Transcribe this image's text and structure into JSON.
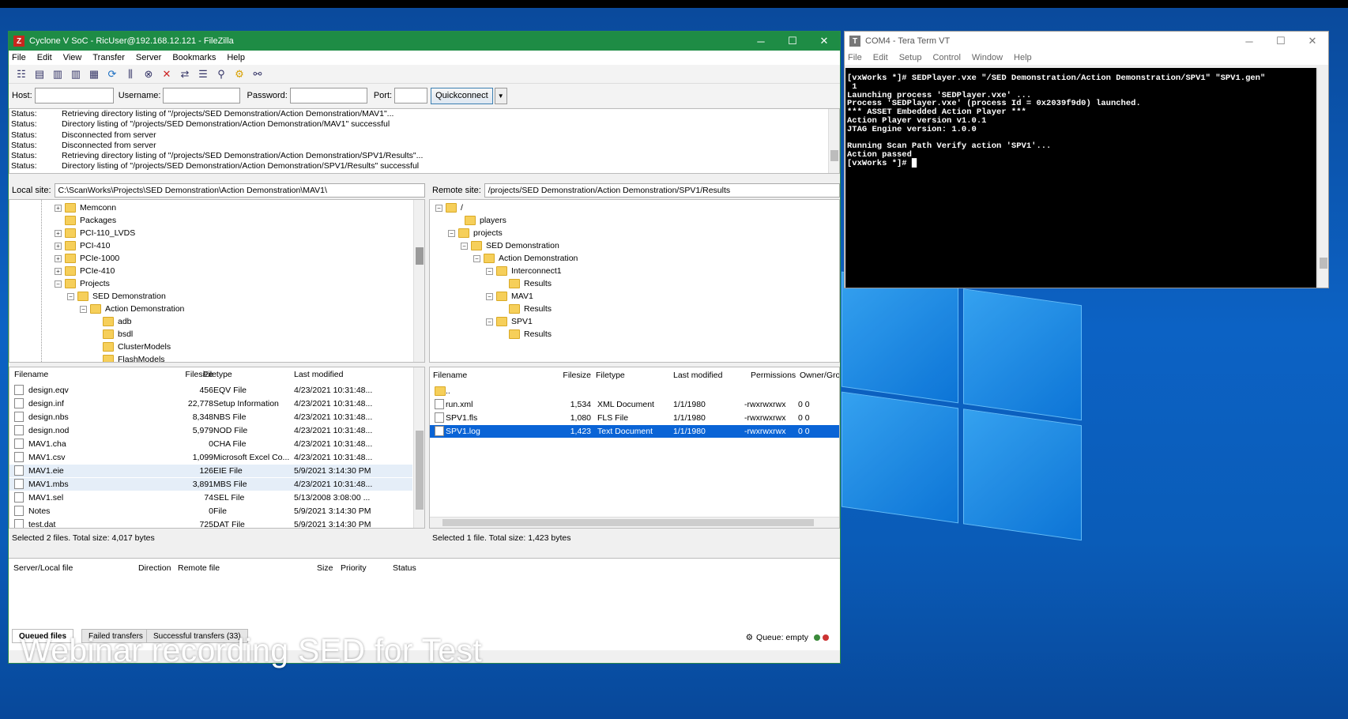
{
  "caption": "Webinar recording SED for Test",
  "filezilla": {
    "title": "Cyclone V SoC - RicUser@192.168.12.121 - FileZilla",
    "window_controls": [
      "─",
      "☐",
      "✕"
    ],
    "menu": [
      "File",
      "Edit",
      "View",
      "Transfer",
      "Server",
      "Bookmarks",
      "Help"
    ],
    "quickconnect": {
      "host_label": "Host:",
      "username_label": "Username:",
      "password_label": "Password:",
      "port_label": "Port:",
      "button": "Quickconnect",
      "host_value": "",
      "username_value": "",
      "password_value": "",
      "port_value": ""
    },
    "log": [
      {
        "k": "Status:",
        "v": "Retrieving directory listing of \"/projects/SED Demonstration/Action Demonstration/MAV1\"..."
      },
      {
        "k": "Status:",
        "v": "Directory listing of \"/projects/SED Demonstration/Action Demonstration/MAV1\" successful"
      },
      {
        "k": "Status:",
        "v": "Disconnected from server"
      },
      {
        "k": "Status:",
        "v": "Disconnected from server"
      },
      {
        "k": "Status:",
        "v": "Retrieving directory listing of \"/projects/SED Demonstration/Action Demonstration/SPV1/Results\"..."
      },
      {
        "k": "Status:",
        "v": "Directory listing of \"/projects/SED Demonstration/Action Demonstration/SPV1/Results\" successful"
      }
    ],
    "local": {
      "label": "Local site:",
      "path": "C:\\ScanWorks\\Projects\\SED Demonstration\\Action Demonstration\\MAV1\\",
      "tree": [
        "Memconn",
        "Packages",
        "PCI-110_LVDS",
        "PCI-410",
        "PCIe-1000",
        "PCIe-410",
        "Projects",
        "SED Demonstration",
        "Action Demonstration",
        "adb",
        "bsdl",
        "ClusterModels",
        "FlashModels"
      ],
      "headers": [
        "Filename",
        "Filesize",
        "Filetype",
        "Last modified"
      ],
      "files": [
        [
          "design.eqv",
          "456",
          "EQV File",
          "4/23/2021 10:31:48..."
        ],
        [
          "design.inf",
          "22,778",
          "Setup Information",
          "4/23/2021 10:31:48..."
        ],
        [
          "design.nbs",
          "8,348",
          "NBS File",
          "4/23/2021 10:31:48..."
        ],
        [
          "design.nod",
          "5,979",
          "NOD File",
          "4/23/2021 10:31:48..."
        ],
        [
          "MAV1.cha",
          "0",
          "CHA File",
          "4/23/2021 10:31:48..."
        ],
        [
          "MAV1.csv",
          "1,099",
          "Microsoft Excel Co...",
          "4/23/2021 10:31:48..."
        ],
        [
          "MAV1.eie",
          "126",
          "EIE File",
          "5/9/2021 3:14:30 PM"
        ],
        [
          "MAV1.mbs",
          "3,891",
          "MBS File",
          "4/23/2021 10:31:48..."
        ],
        [
          "MAV1.sel",
          "74",
          "SEL File",
          "5/13/2008 3:08:00 ..."
        ],
        [
          "Notes",
          "0",
          "File",
          "5/9/2021 3:14:30 PM"
        ],
        [
          "test.dat",
          "725",
          "DAT File",
          "5/9/2021 3:14:30 PM"
        ]
      ],
      "status": "Selected 2 files. Total size: 4,017 bytes"
    },
    "remote": {
      "label": "Remote site:",
      "path": "/projects/SED Demonstration/Action Demonstration/SPV1/Results",
      "tree": [
        "/",
        "players",
        "projects",
        "SED Demonstration",
        "Action Demonstration",
        "Interconnect1",
        "Results",
        "MAV1",
        "Results",
        "SPV1",
        "Results"
      ],
      "headers": [
        "Filename",
        "Filesize",
        "Filetype",
        "Last modified",
        "Permissions",
        "Owner/Gro"
      ],
      "files": [
        [
          "..",
          "",
          "",
          "",
          "",
          ""
        ],
        [
          "run.xml",
          "1,534",
          "XML Document",
          "1/1/1980",
          "-rwxrwxrwx",
          "0 0"
        ],
        [
          "SPV1.fls",
          "1,080",
          "FLS File",
          "1/1/1980",
          "-rwxrwxrwx",
          "0 0"
        ],
        [
          "SPV1.log",
          "1,423",
          "Text Document",
          "1/1/1980",
          "-rwxrwxrwx",
          "0 0"
        ]
      ],
      "status": "Selected 1 file. Total size: 1,423 bytes"
    },
    "queue": {
      "headers": [
        "Server/Local file",
        "Direction",
        "Remote file",
        "Size",
        "Priority",
        "Status"
      ],
      "tabs": [
        "Queued files",
        "Failed transfers",
        "Successful transfers (33)"
      ],
      "status": "Queue: empty"
    }
  },
  "teraterm": {
    "title": "COM4 - Tera Term VT",
    "window_controls": [
      "─",
      "☐",
      "✕"
    ],
    "menu": [
      "File",
      "Edit",
      "Setup",
      "Control",
      "Window",
      "Help"
    ],
    "terminal": "[vxWorks *]# SEDPlayer.vxe \"/SED Demonstration/Action Demonstration/SPV1\" \"SPV1.gen\"\n 1\nLaunching process 'SEDPlayer.vxe' ...\nProcess 'SEDPlayer.vxe' (process Id = 0x2039f9d0) launched.\n*** ASSET Embedded Action Player ***\nAction Player version v1.0.1\nJTAG Engine version: 1.0.0\n\nRunning Scan Path Verify action 'SPV1'...\nAction passed\n[vxWorks *]# █"
  }
}
